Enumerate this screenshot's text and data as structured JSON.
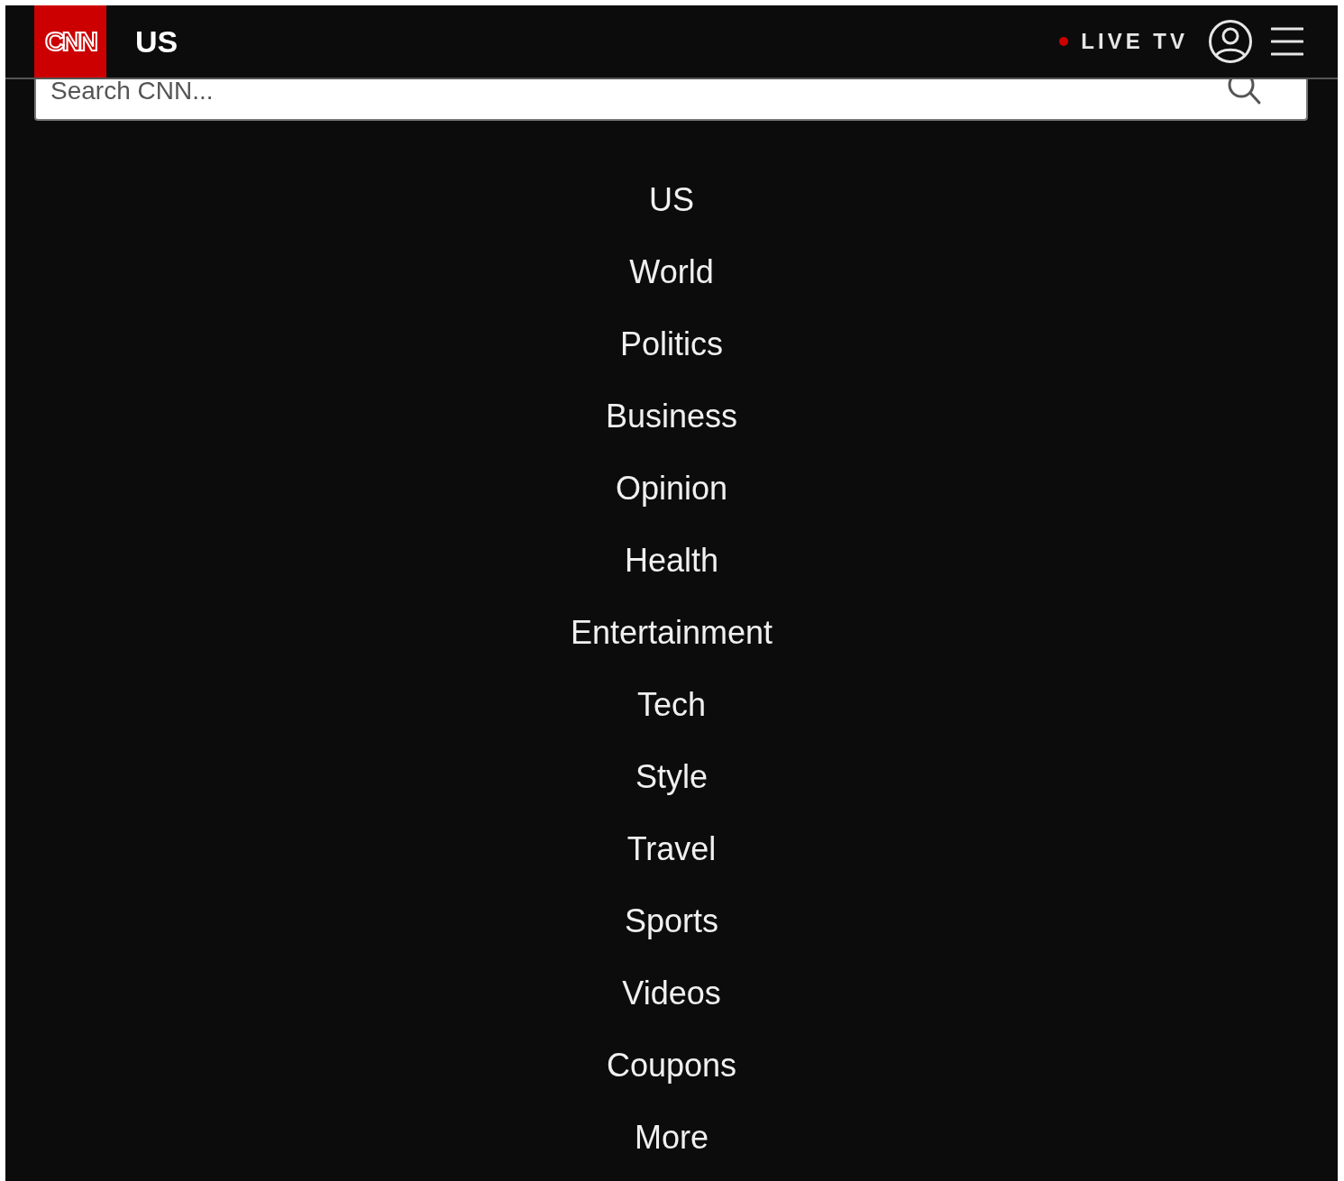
{
  "header": {
    "logo": "CNN",
    "section": "US",
    "live": {
      "label": "LIVE TV",
      "on": true
    }
  },
  "search": {
    "placeholder": "Search CNN..."
  },
  "nav": [
    {
      "label": "US"
    },
    {
      "label": "World"
    },
    {
      "label": "Politics"
    },
    {
      "label": "Business"
    },
    {
      "label": "Opinion"
    },
    {
      "label": "Health"
    },
    {
      "label": "Entertainment"
    },
    {
      "label": "Tech"
    },
    {
      "label": "Style"
    },
    {
      "label": "Travel"
    },
    {
      "label": "Sports"
    },
    {
      "label": "Videos"
    },
    {
      "label": "Coupons"
    },
    {
      "label": "More"
    }
  ]
}
